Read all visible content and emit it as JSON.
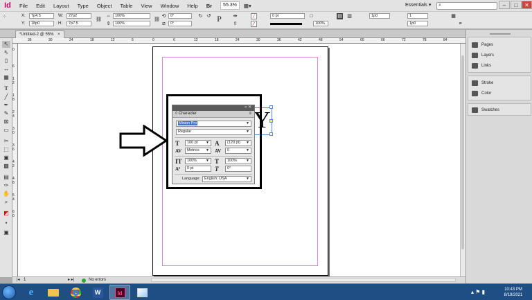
{
  "menubar": {
    "logo": "Id",
    "items": [
      "File",
      "Edit",
      "Layout",
      "Type",
      "Object",
      "Table",
      "View",
      "Window",
      "Help"
    ],
    "zoom": "55.3%",
    "workspace": "Essentials ▾",
    "win_min": "–",
    "win_max": "□",
    "win_close": "✕"
  },
  "control": {
    "x_label": "X:",
    "x_value": "7p4.5",
    "y_label": "Y:",
    "y_value": "18p0",
    "w_label": "W:",
    "w_value": "27p2",
    "h_label": "H:",
    "h_value": "7p7.5",
    "scale_x": "100%",
    "scale_y": "100%",
    "rotate": "0°",
    "shear": "0°",
    "stroke_weight": "0 pt",
    "opacity": "100%",
    "ref_1": "1p0",
    "col_count": "1",
    "ref_2": "1p0"
  },
  "tab": {
    "title": "*Untitled-2 @ 55%",
    "close": "×"
  },
  "ruler": {
    "h_numbers": [
      "36",
      "30",
      "24",
      "18",
      "12",
      "6",
      "0",
      "6",
      "12",
      "18",
      "24",
      "30",
      "36",
      "42",
      "48",
      "54",
      "60",
      "66",
      "72",
      "78",
      "84"
    ],
    "v_numbers": [
      "0",
      "6",
      "1",
      "2",
      "1",
      "8",
      "2",
      "4",
      "3",
      "0",
      "3",
      "6",
      "4",
      "2",
      "4",
      "8",
      "5",
      "4",
      "6",
      "0"
    ]
  },
  "status": {
    "page": "1",
    "errors": "No errors"
  },
  "panels": {
    "items": [
      "Pages",
      "Layers",
      "Links",
      "Stroke",
      "Color",
      "Swatches"
    ]
  },
  "character_panel": {
    "tab": "◊ Character",
    "font": "Minion Pro",
    "style": "Regular",
    "size": "100 pt",
    "leading": "(120 pt)",
    "kerning": "Metrics",
    "tracking": "0",
    "vscale": "100%",
    "hscale": "100%",
    "baseline": "0 pt",
    "skew": "0°",
    "language_label": "Language:",
    "language": "English: USA"
  },
  "frame": {
    "glyph": "Y"
  },
  "taskbar": {
    "time": "10:43 PM",
    "date": "8/19/2021",
    "apps": [
      "ie",
      "explorer",
      "chrome",
      "word",
      "indesign",
      "paint"
    ]
  },
  "colors": {
    "accent": "#d9006c",
    "margin_guide": "#d58bd8",
    "taskbar": "#1f4e85",
    "selection": "#5a8bd6"
  }
}
